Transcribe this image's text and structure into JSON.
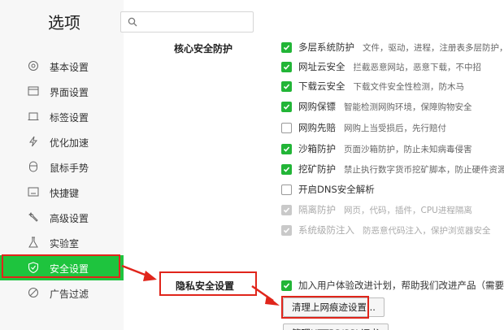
{
  "header": {
    "title": "选项",
    "search": {
      "value": "",
      "placeholder": ""
    }
  },
  "sidebar": {
    "items": [
      {
        "label": "基本设置",
        "icon": "gear-icon"
      },
      {
        "label": "界面设置",
        "icon": "window-icon"
      },
      {
        "label": "标签设置",
        "icon": "tab-icon"
      },
      {
        "label": "优化加速",
        "icon": "lightning-icon"
      },
      {
        "label": "鼠标手势",
        "icon": "mouse-icon"
      },
      {
        "label": "快捷键",
        "icon": "keyboard-icon"
      },
      {
        "label": "高级设置",
        "icon": "wrench-icon"
      },
      {
        "label": "实验室",
        "icon": "flask-icon"
      },
      {
        "label": "安全设置",
        "icon": "shield-icon",
        "active": true
      },
      {
        "label": "广告过滤",
        "icon": "block-icon"
      }
    ]
  },
  "sections": {
    "core": {
      "title": "核心安全防护",
      "options": [
        {
          "name": "多层系统防护",
          "desc": "文件，驱动，进程，注册表多层防护，保护",
          "state": "checked"
        },
        {
          "name": "网址云安全",
          "desc": "拦截恶意网站，恶意下载，不中招",
          "state": "checked"
        },
        {
          "name": "下载云安全",
          "desc": "下载文件安全性检测，防木马",
          "state": "checked"
        },
        {
          "name": "网购保镖",
          "desc": "智能检测网购环境，保障购物安全",
          "state": "checked"
        },
        {
          "name": "网购先赔",
          "desc": "网购上当受损后，先行赔付",
          "state": "unchecked"
        },
        {
          "name": "沙箱防护",
          "desc": "页面沙箱防护，防止未知病毒侵害",
          "state": "checked"
        },
        {
          "name": "挖矿防护",
          "desc": "禁止执行数字货币挖矿脚本，防止硬件资源被利",
          "state": "checked"
        },
        {
          "name": "开启DNS安全解析",
          "desc": "",
          "state": "unchecked"
        },
        {
          "name": "隔离防护",
          "desc": "网页，代码，插件，CPU进程隔离",
          "state": "disabled"
        },
        {
          "name": "系统级防注入",
          "desc": "防恶意代码注入，保护浏览器安全",
          "state": "disabled"
        }
      ]
    },
    "privacy": {
      "title": "隐私安全设置",
      "option": {
        "name": "加入用户体验改进计划，帮助我们改进产品（需要重启",
        "state": "checked"
      },
      "clear_button": "清理上网痕迹设置...",
      "next_button": "管理HTTPS/SSL证书"
    }
  },
  "colors": {
    "accent": "#1ec43e",
    "check": "#22b537",
    "highlight": "#e0251b"
  }
}
